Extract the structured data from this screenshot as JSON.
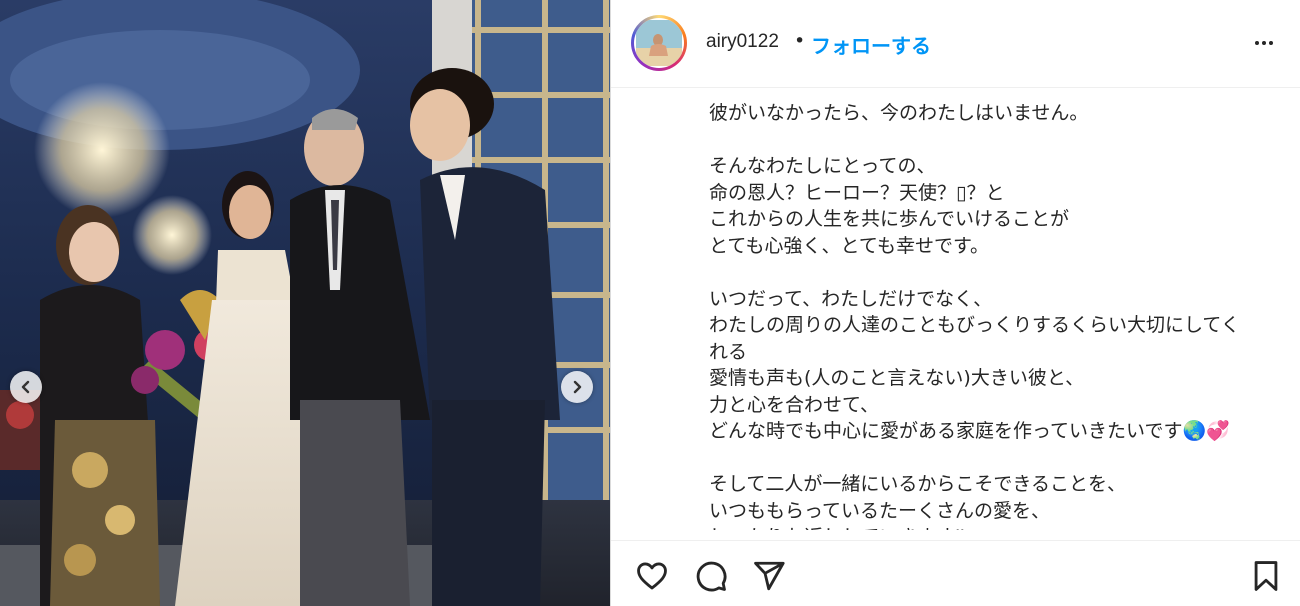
{
  "post": {
    "username": "airy0122",
    "separator": "•",
    "follow_label": "フォローする",
    "caption_paragraphs": [
      [
        "彼がいなかったら、今のわたしはいません。"
      ],
      [
        "そんなわたしにとっての、",
        "命の恩人？ヒーロー？天使？▯？と",
        "これからの人生を共に歩んでいけることが",
        "とても心強く、とても幸せです。"
      ],
      [
        "いつだって、わたしだけでなく、",
        "わたしの周りの人達のこともびっくりするくらい大切にしてく",
        "れる",
        "愛情も声も(人のこと言えない)大きい彼と、",
        "力と心を合わせて、",
        "どんな時でも中心に愛がある家庭を作っていきたいです🌏💞"
      ],
      [
        "そして二人が一緒にいるからこそできることを、",
        "いつももらっているたーくさんの愛を、",
        "しっかりお返ししていきます‼"
      ]
    ]
  },
  "icons": {
    "more": "more-options-icon",
    "like": "heart-icon",
    "comment": "comment-icon",
    "share": "share-icon",
    "save": "bookmark-icon",
    "prev": "chevron-left-icon",
    "next": "chevron-right-icon"
  },
  "colors": {
    "link_blue": "#0095f6",
    "text": "#262626",
    "border": "#dbdbdb"
  }
}
